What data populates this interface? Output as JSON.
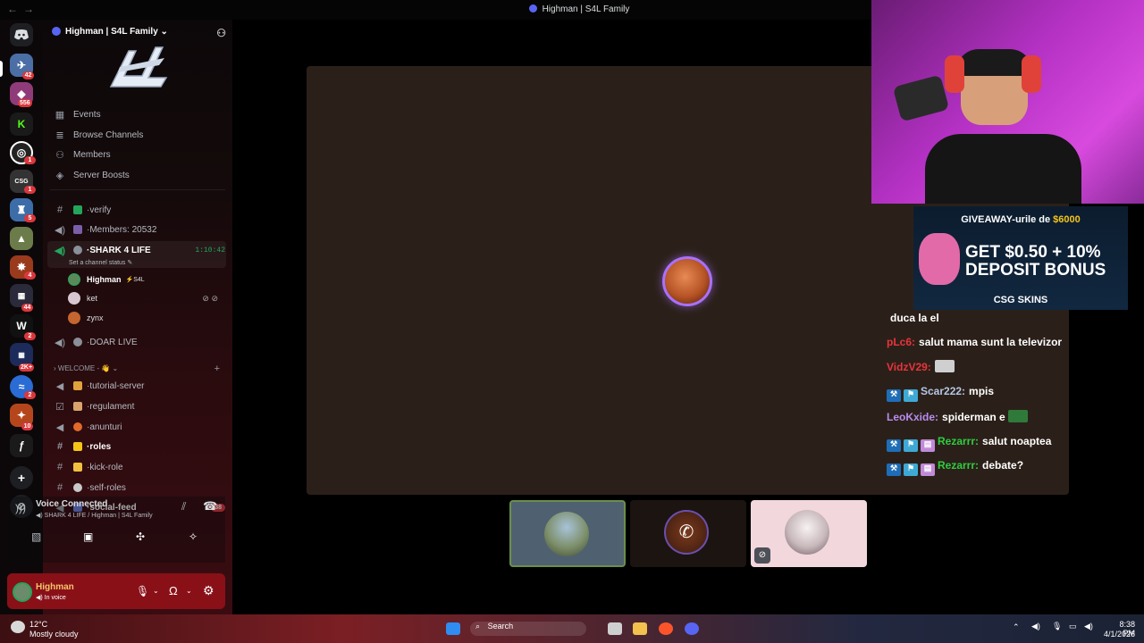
{
  "window": {
    "title": "Highman | S4L Family"
  },
  "rail": {
    "badges": [
      "42",
      "556",
      "1",
      "1",
      "5",
      "4",
      "44",
      "2",
      "2K+",
      "2",
      "10"
    ]
  },
  "server": {
    "name": "Highman | S4L Family",
    "menu": [
      "Events",
      "Browse Channels",
      "Members",
      "Server Boosts"
    ],
    "channels": {
      "verify": "verify",
      "members": "Members: 20532",
      "shark": "SHARK 4 LIFE",
      "shark_time": "1:10:42",
      "shark_status": "Set a channel status",
      "doar": "DOAR LIVE"
    },
    "voice_users": [
      {
        "name": "Highman",
        "tag": "S4L"
      },
      {
        "name": "ket"
      },
      {
        "name": "zynx"
      }
    ],
    "category": "WELCOME",
    "welcome_channels": [
      "tutorial-server",
      "regulament",
      "anunturi",
      "roles",
      "kick-role",
      "self-roles",
      "social-feed"
    ],
    "social_feed_badge": "38"
  },
  "voice": {
    "status": "Voice Connected",
    "location": "SHARK 4 LIFE / Highman | S4L Family"
  },
  "user": {
    "name": "Highman",
    "status": "In voice"
  },
  "overlay": {
    "ad_top": "GIVEAWAY-urile de",
    "ad_amount": "$6000",
    "ad_main1": "GET $0.50 + 10%",
    "ad_main2": "DEPOSIT BONUS",
    "ad_brand": "CSG SKINS"
  },
  "chat": [
    {
      "user": "",
      "text": "duca la el",
      "color": "#ffffff"
    },
    {
      "user": "pLc6:",
      "text": "salut mama sunt la televizor",
      "color": "#e8343c"
    },
    {
      "user": "VidzV29:",
      "text": "",
      "color": "#e8343c"
    },
    {
      "user": "Scar222:",
      "text": "mpis",
      "color": "#b5c7e6"
    },
    {
      "user": "LeoKxide:",
      "text": "spiderman e",
      "color": "#b78cf0"
    },
    {
      "user": "Rezarrr:",
      "text": "salut noaptea",
      "color": "#2ecc40"
    },
    {
      "user": "Rezarrr:",
      "text": "debate?",
      "color": "#2ecc40"
    }
  ],
  "taskbar": {
    "temp": "12°C",
    "weather": "Mostly cloudy",
    "search": "Search",
    "time": "8:38 PM",
    "date": "4/1/2026"
  }
}
